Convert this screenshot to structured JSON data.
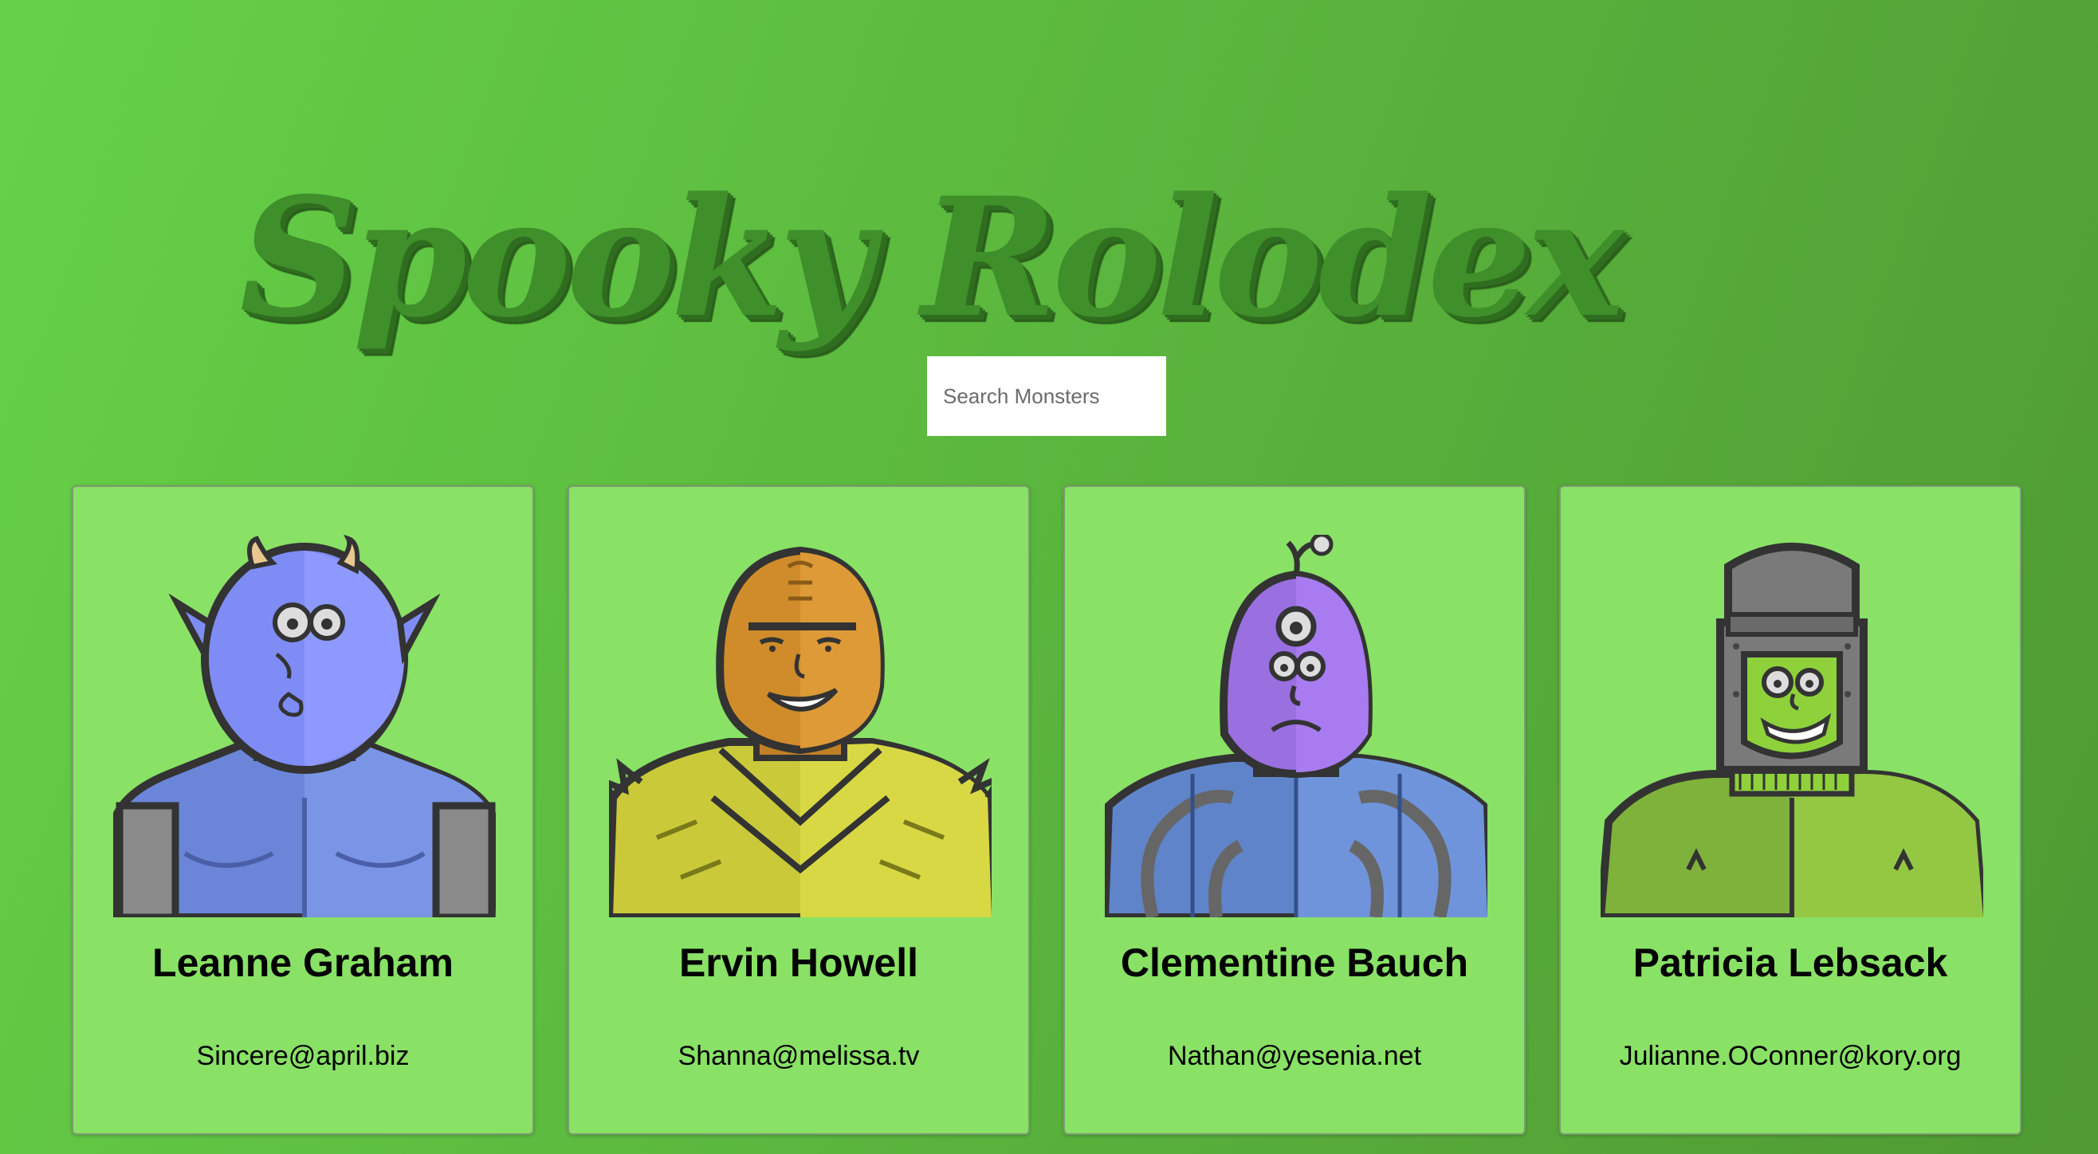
{
  "header": {
    "title": "Spooky Rolodex"
  },
  "search": {
    "placeholder": "Search Monsters"
  },
  "monsters": [
    {
      "name": "Leanne Graham",
      "email": "Sincere@april.biz",
      "avatar": "blue-horned-monster",
      "color": "#7f8cf5"
    },
    {
      "name": "Ervin Howell",
      "email": "Shanna@melissa.tv",
      "avatar": "orange-helmet-monster",
      "color": "#d08c2a"
    },
    {
      "name": "Clementine Bauch",
      "email": "Nathan@yesenia.net",
      "avatar": "purple-cyclops-monster",
      "color": "#9a6fe0"
    },
    {
      "name": "Patricia Lebsack",
      "email": "Julianne.OConner@kory.org",
      "avatar": "green-robot-monster",
      "color": "#8ed13a"
    }
  ]
}
